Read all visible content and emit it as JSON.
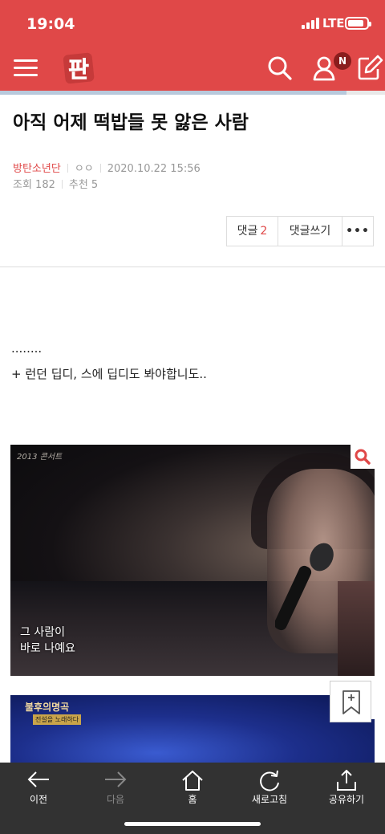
{
  "status": {
    "time": "19:04",
    "network": "LTE"
  },
  "header": {
    "logo_text": "판",
    "notification_badge": "N"
  },
  "article": {
    "title": "아직 어제 떡밥들 못 앓은 사람",
    "category": "방탄소년단",
    "author": "ㅇㅇ",
    "datetime": "2020.10.22 15:56",
    "views_label": "조회 182",
    "recommend_label": "추천 5",
    "body_line1": "........",
    "body_line2": "+ 런던 딥디, 스에 딥디도 봐야합니도..",
    "image1_caption_line1": "그 사람이",
    "image1_caption_line2": "바로 나예요",
    "image1_logo": "2013 콘서트",
    "image2_title": "불후의명곡",
    "image2_sub": "전설을 노래하다"
  },
  "actions": {
    "comments_label": "댓글",
    "comments_count": "2",
    "write_label": "댓글쓰기",
    "more_label": "•••"
  },
  "bottom_nav": [
    {
      "label": "이전",
      "icon": "arrow-left-icon",
      "enabled": true
    },
    {
      "label": "다음",
      "icon": "arrow-right-icon",
      "enabled": false
    },
    {
      "label": "홈",
      "icon": "home-icon",
      "enabled": true
    },
    {
      "label": "새로고침",
      "icon": "refresh-icon",
      "enabled": true
    },
    {
      "label": "공유하기",
      "icon": "share-icon",
      "enabled": true
    }
  ],
  "reading_progress": 0.9,
  "colors": {
    "brand": "#e04848",
    "bottom_bar": "#323232"
  }
}
